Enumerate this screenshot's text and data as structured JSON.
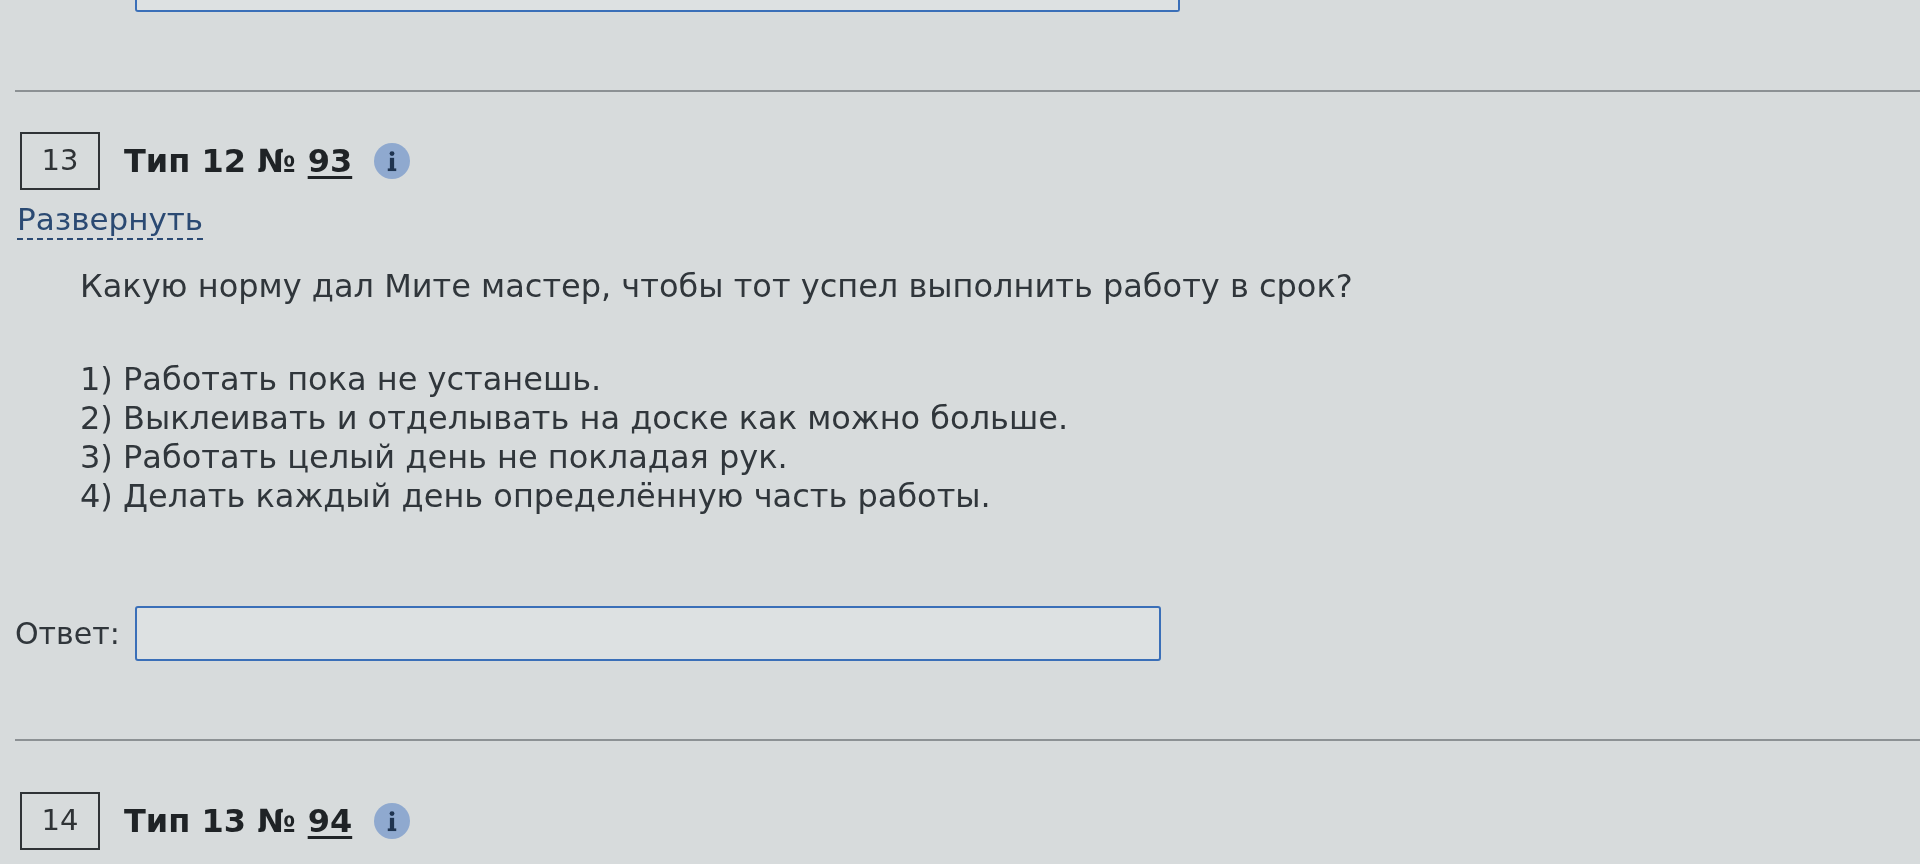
{
  "tasks": [
    {
      "kind": "answer_tail"
    },
    {
      "kind": "full",
      "number": "13",
      "title": "Тип 12 №",
      "link": "93",
      "expand_link": "Развернуть",
      "question": "Какую норму дал Мите мастер, чтобы тот успел выполнить работу в срок?",
      "options": [
        "1) Работать пока не устанешь.",
        "2) Выклеивать и отделывать на доске как можно больше.",
        "3) Работать целый день не покладая рук.",
        "4) Делать каждый день определённую часть работы."
      ],
      "answer_label": "Ответ:"
    },
    {
      "kind": "header",
      "number": "14",
      "title": "Тип 13 №",
      "link": "94"
    }
  ]
}
